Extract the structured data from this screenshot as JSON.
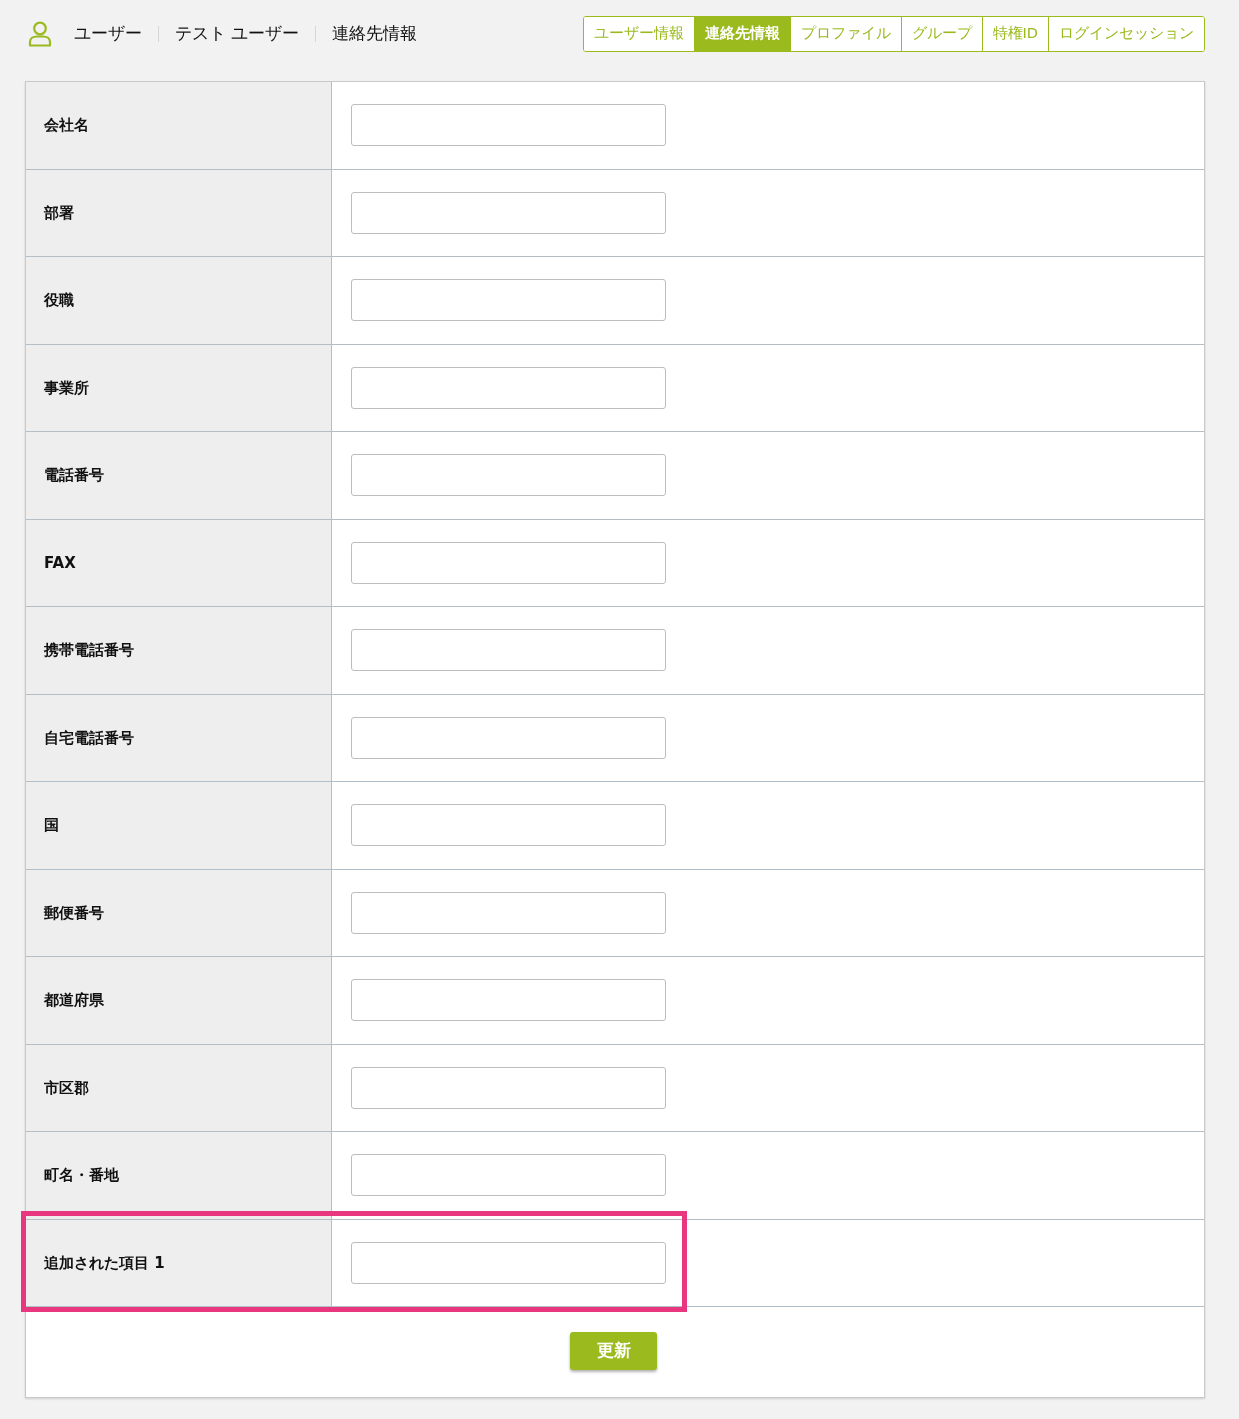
{
  "breadcrumb": [
    {
      "label": "ユーザー"
    },
    {
      "label": "テスト ユーザー"
    },
    {
      "label": "連絡先情報"
    }
  ],
  "tabs": [
    {
      "label": "ユーザー情報",
      "selected": false
    },
    {
      "label": "連絡先情報",
      "selected": true
    },
    {
      "label": "プロファイル",
      "selected": false
    },
    {
      "label": "グループ",
      "selected": false
    },
    {
      "label": "特権ID",
      "selected": false
    },
    {
      "label": "ログインセッション",
      "selected": false
    }
  ],
  "form": {
    "rows": [
      {
        "label": "会社名",
        "highlighted": false
      },
      {
        "label": "部署",
        "highlighted": false
      },
      {
        "label": "役職",
        "highlighted": false
      },
      {
        "label": "事業所",
        "highlighted": false
      },
      {
        "label": "電話番号",
        "highlighted": false
      },
      {
        "label": "FAX",
        "highlighted": false
      },
      {
        "label": "携帯電話番号",
        "highlighted": false
      },
      {
        "label": "自宅電話番号",
        "highlighted": false
      },
      {
        "label": "国",
        "highlighted": false
      },
      {
        "label": "郵便番号",
        "highlighted": false
      },
      {
        "label": "都道府県",
        "highlighted": false
      },
      {
        "label": "市区郡",
        "highlighted": false
      },
      {
        "label": "町名・番地",
        "highlighted": false
      },
      {
        "label": "追加された項目 1",
        "highlighted": true
      }
    ],
    "submit_button": "更新"
  }
}
